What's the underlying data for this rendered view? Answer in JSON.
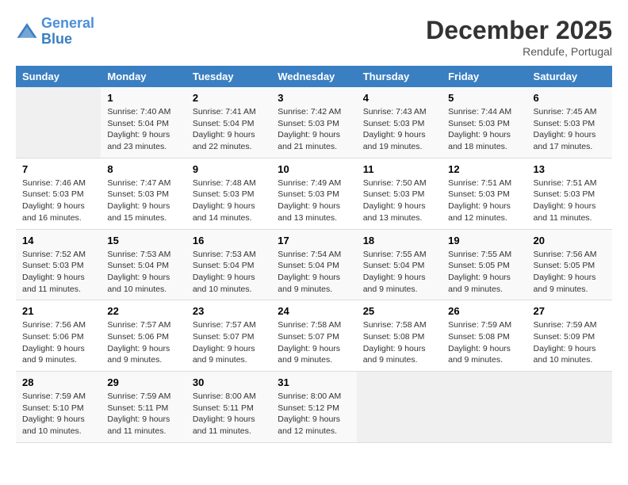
{
  "header": {
    "logo_line1": "General",
    "logo_line2": "Blue",
    "month": "December 2025",
    "location": "Rendufe, Portugal"
  },
  "weekdays": [
    "Sunday",
    "Monday",
    "Tuesday",
    "Wednesday",
    "Thursday",
    "Friday",
    "Saturday"
  ],
  "weeks": [
    [
      {
        "day": "",
        "info": ""
      },
      {
        "day": "1",
        "info": "Sunrise: 7:40 AM\nSunset: 5:04 PM\nDaylight: 9 hours\nand 23 minutes."
      },
      {
        "day": "2",
        "info": "Sunrise: 7:41 AM\nSunset: 5:04 PM\nDaylight: 9 hours\nand 22 minutes."
      },
      {
        "day": "3",
        "info": "Sunrise: 7:42 AM\nSunset: 5:03 PM\nDaylight: 9 hours\nand 21 minutes."
      },
      {
        "day": "4",
        "info": "Sunrise: 7:43 AM\nSunset: 5:03 PM\nDaylight: 9 hours\nand 19 minutes."
      },
      {
        "day": "5",
        "info": "Sunrise: 7:44 AM\nSunset: 5:03 PM\nDaylight: 9 hours\nand 18 minutes."
      },
      {
        "day": "6",
        "info": "Sunrise: 7:45 AM\nSunset: 5:03 PM\nDaylight: 9 hours\nand 17 minutes."
      }
    ],
    [
      {
        "day": "7",
        "info": "Sunrise: 7:46 AM\nSunset: 5:03 PM\nDaylight: 9 hours\nand 16 minutes."
      },
      {
        "day": "8",
        "info": "Sunrise: 7:47 AM\nSunset: 5:03 PM\nDaylight: 9 hours\nand 15 minutes."
      },
      {
        "day": "9",
        "info": "Sunrise: 7:48 AM\nSunset: 5:03 PM\nDaylight: 9 hours\nand 14 minutes."
      },
      {
        "day": "10",
        "info": "Sunrise: 7:49 AM\nSunset: 5:03 PM\nDaylight: 9 hours\nand 13 minutes."
      },
      {
        "day": "11",
        "info": "Sunrise: 7:50 AM\nSunset: 5:03 PM\nDaylight: 9 hours\nand 13 minutes."
      },
      {
        "day": "12",
        "info": "Sunrise: 7:51 AM\nSunset: 5:03 PM\nDaylight: 9 hours\nand 12 minutes."
      },
      {
        "day": "13",
        "info": "Sunrise: 7:51 AM\nSunset: 5:03 PM\nDaylight: 9 hours\nand 11 minutes."
      }
    ],
    [
      {
        "day": "14",
        "info": "Sunrise: 7:52 AM\nSunset: 5:03 PM\nDaylight: 9 hours\nand 11 minutes."
      },
      {
        "day": "15",
        "info": "Sunrise: 7:53 AM\nSunset: 5:04 PM\nDaylight: 9 hours\nand 10 minutes."
      },
      {
        "day": "16",
        "info": "Sunrise: 7:53 AM\nSunset: 5:04 PM\nDaylight: 9 hours\nand 10 minutes."
      },
      {
        "day": "17",
        "info": "Sunrise: 7:54 AM\nSunset: 5:04 PM\nDaylight: 9 hours\nand 9 minutes."
      },
      {
        "day": "18",
        "info": "Sunrise: 7:55 AM\nSunset: 5:04 PM\nDaylight: 9 hours\nand 9 minutes."
      },
      {
        "day": "19",
        "info": "Sunrise: 7:55 AM\nSunset: 5:05 PM\nDaylight: 9 hours\nand 9 minutes."
      },
      {
        "day": "20",
        "info": "Sunrise: 7:56 AM\nSunset: 5:05 PM\nDaylight: 9 hours\nand 9 minutes."
      }
    ],
    [
      {
        "day": "21",
        "info": "Sunrise: 7:56 AM\nSunset: 5:06 PM\nDaylight: 9 hours\nand 9 minutes."
      },
      {
        "day": "22",
        "info": "Sunrise: 7:57 AM\nSunset: 5:06 PM\nDaylight: 9 hours\nand 9 minutes."
      },
      {
        "day": "23",
        "info": "Sunrise: 7:57 AM\nSunset: 5:07 PM\nDaylight: 9 hours\nand 9 minutes."
      },
      {
        "day": "24",
        "info": "Sunrise: 7:58 AM\nSunset: 5:07 PM\nDaylight: 9 hours\nand 9 minutes."
      },
      {
        "day": "25",
        "info": "Sunrise: 7:58 AM\nSunset: 5:08 PM\nDaylight: 9 hours\nand 9 minutes."
      },
      {
        "day": "26",
        "info": "Sunrise: 7:59 AM\nSunset: 5:08 PM\nDaylight: 9 hours\nand 9 minutes."
      },
      {
        "day": "27",
        "info": "Sunrise: 7:59 AM\nSunset: 5:09 PM\nDaylight: 9 hours\nand 10 minutes."
      }
    ],
    [
      {
        "day": "28",
        "info": "Sunrise: 7:59 AM\nSunset: 5:10 PM\nDaylight: 9 hours\nand 10 minutes."
      },
      {
        "day": "29",
        "info": "Sunrise: 7:59 AM\nSunset: 5:11 PM\nDaylight: 9 hours\nand 11 minutes."
      },
      {
        "day": "30",
        "info": "Sunrise: 8:00 AM\nSunset: 5:11 PM\nDaylight: 9 hours\nand 11 minutes."
      },
      {
        "day": "31",
        "info": "Sunrise: 8:00 AM\nSunset: 5:12 PM\nDaylight: 9 hours\nand 12 minutes."
      },
      {
        "day": "",
        "info": ""
      },
      {
        "day": "",
        "info": ""
      },
      {
        "day": "",
        "info": ""
      }
    ]
  ]
}
